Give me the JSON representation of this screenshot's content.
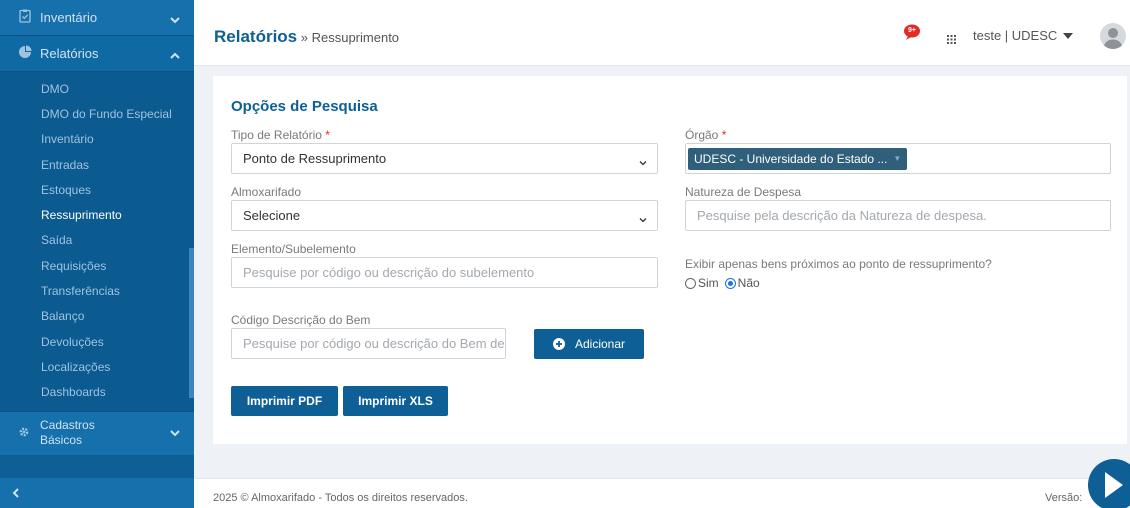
{
  "sidebar": {
    "inventario_label": "Inventário",
    "relatorios_label": "Relatórios",
    "items": [
      {
        "label": "DMO"
      },
      {
        "label": "DMO do Fundo Especial"
      },
      {
        "label": "Inventário"
      },
      {
        "label": "Entradas"
      },
      {
        "label": "Estoques"
      },
      {
        "label": "Ressuprimento"
      },
      {
        "label": "Saída"
      },
      {
        "label": "Requisições"
      },
      {
        "label": "Transferências"
      },
      {
        "label": "Balanço"
      },
      {
        "label": "Devoluções"
      },
      {
        "label": "Localizações"
      },
      {
        "label": "Dashboards"
      }
    ],
    "cadastros_line1": "Cadastros",
    "cadastros_line2": "Básicos"
  },
  "header": {
    "title": "Relatórios",
    "breadcrumb": "» Ressuprimento",
    "notif_badge": "9+",
    "user_label": "teste | UDESC"
  },
  "form": {
    "section_title": "Opções de Pesquisa",
    "tipo_label": "Tipo de Relatório",
    "tipo_value": "Ponto de Ressuprimento",
    "orgao_label": "Órgão",
    "orgao_tag": "UDESC - Universidade do Estado ...",
    "almox_label": "Almoxarifado",
    "almox_value": "Selecione",
    "natureza_label": "Natureza de Despesa",
    "natureza_placeholder": "Pesquise pela descrição da Natureza de despesa.",
    "elemento_label": "Elemento/Subelemento",
    "elemento_placeholder": "Pesquise por código ou descrição do subelemento",
    "exibir_label": "Exibir apenas bens próximos ao ponto de ressuprimento?",
    "opt_sim": "Sim",
    "opt_nao": "Não",
    "codigo_label": "Código Descrição do Bem",
    "codigo_placeholder": "Pesquise por código ou descrição do Bem de consumo",
    "adicionar_label": "Adicionar",
    "pdf_label": "Imprimir PDF",
    "xls_label": "Imprimir XLS",
    "required_mark": "*"
  },
  "footer": {
    "copyright": "2025 © Almoxarifado - Todos os direitos reservados.",
    "version_label": "Versão:"
  },
  "colors": {
    "sidebar": "#0d5f96",
    "accent": "#0d5f96",
    "required": "#e02b27"
  }
}
